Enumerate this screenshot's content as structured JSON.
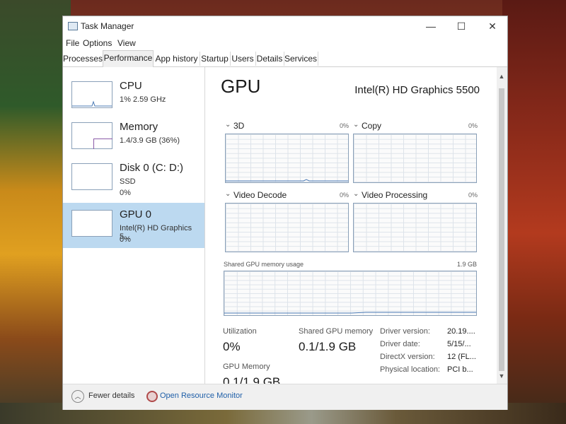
{
  "window": {
    "title": "Task Manager"
  },
  "window_buttons": {
    "minimize": "—",
    "maximize": "☐",
    "close": "✕"
  },
  "menu": [
    "File",
    "Options",
    "View"
  ],
  "tabs": [
    {
      "label": "Processes"
    },
    {
      "label": "Performance"
    },
    {
      "label": "App history"
    },
    {
      "label": "Startup"
    },
    {
      "label": "Users"
    },
    {
      "label": "Details"
    },
    {
      "label": "Services"
    }
  ],
  "sidebar": {
    "items": [
      {
        "title": "CPU",
        "line1": "1% 2.59 GHz",
        "line2": ""
      },
      {
        "title": "Memory",
        "line1": "1.4/3.9 GB (36%)",
        "line2": ""
      },
      {
        "title": "Disk 0 (C: D:)",
        "line1": "SSD",
        "line2": "0%"
      },
      {
        "title": "GPU 0",
        "line1": "Intel(R) HD Graphics 5...",
        "line2": "0%"
      }
    ]
  },
  "main": {
    "title": "GPU",
    "model": "Intel(R) HD Graphics 5500",
    "engines": [
      {
        "label": "3D",
        "percent": "0%"
      },
      {
        "label": "Copy",
        "percent": "0%"
      },
      {
        "label": "Video Decode",
        "percent": "0%"
      },
      {
        "label": "Video Processing",
        "percent": "0%"
      }
    ],
    "chevron": "⌄",
    "shared_memory": {
      "label": "Shared GPU memory usage",
      "max": "1.9 GB"
    },
    "stats": {
      "utilization_label": "Utilization",
      "utilization_value": "0%",
      "shared_label": "Shared GPU memory",
      "shared_value": "0.1/1.9 GB",
      "gpu_memory_label": "GPU Memory",
      "gpu_memory_value": "0.1/1.9 GB"
    },
    "info": [
      {
        "label": "Driver version:",
        "value": "20.19...."
      },
      {
        "label": "Driver date:",
        "value": "5/15/..."
      },
      {
        "label": "DirectX version:",
        "value": "12 (FL..."
      },
      {
        "label": "Physical location:",
        "value": "PCI b..."
      }
    ]
  },
  "scroll": {
    "up": "▲",
    "down": "▼"
  },
  "footer": {
    "fewer_icon": "︿",
    "fewer_details": "Fewer details",
    "open_resource_monitor": "Open Resource Monitor"
  }
}
